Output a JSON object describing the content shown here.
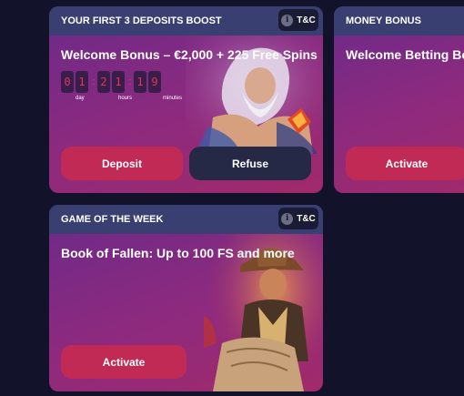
{
  "cards": [
    {
      "header": "YOUR FIRST 3 DEPOSITS BOOST",
      "tc_label": "T&C",
      "title": "Welcome Bonus – €2,000 + 225 Free Spins",
      "timer": {
        "digits": [
          "0",
          "1",
          "2",
          "1",
          "1",
          "9"
        ],
        "labels": {
          "day": "day",
          "hours": "hours",
          "minutes": "minutes"
        }
      },
      "buttons": {
        "primary": "Deposit",
        "secondary": "Refuse"
      }
    },
    {
      "header": "MONEY BONUS",
      "title": "Welcome Betting Bonus",
      "buttons": {
        "primary": "Activate"
      }
    },
    {
      "header": "GAME OF THE WEEK",
      "tc_label": "T&C",
      "title": "Book of Fallen: Up to 100 FS and more",
      "buttons": {
        "primary": "Activate"
      }
    }
  ],
  "colors": {
    "background": "#12132b",
    "header": "#3a3f72",
    "button_primary": "#c12a55",
    "button_secondary": "#252946",
    "timer_digit": "#e0345a"
  },
  "icons": [
    "info-icon",
    "zeus-artwork",
    "explorer-artwork"
  ]
}
